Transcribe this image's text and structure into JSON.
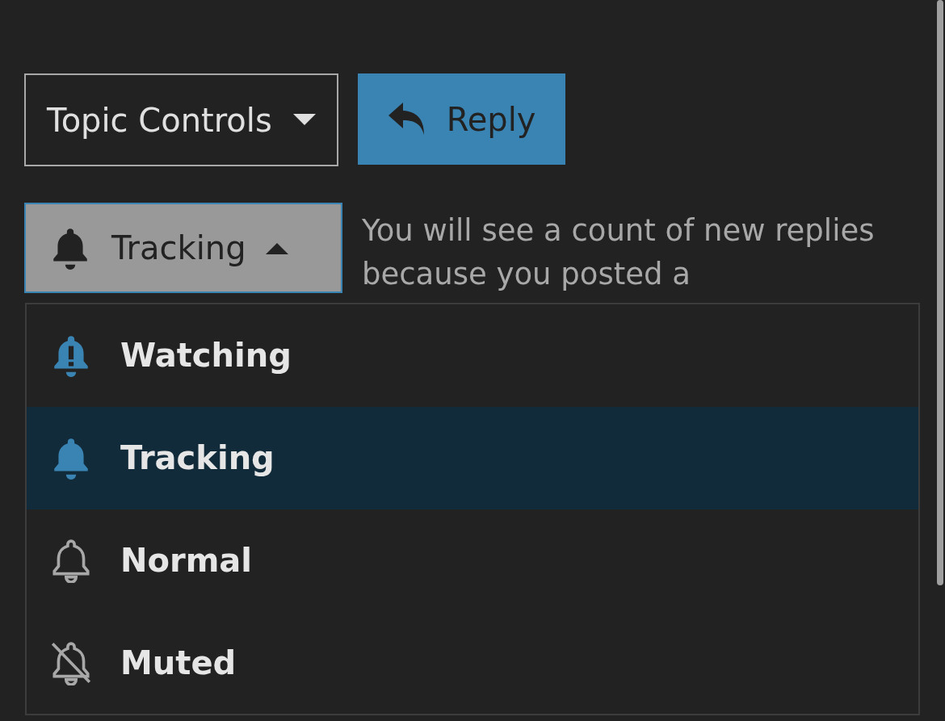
{
  "topic_controls": {
    "label": "Topic Controls",
    "expanded": false
  },
  "reply_button": {
    "label": "Reply"
  },
  "notification_button": {
    "label": "Tracking",
    "expanded": true
  },
  "notification_description": "You will see a count of new replies because you posted a",
  "notification_menu": [
    {
      "kind": "watching",
      "label": "Watching",
      "selected": false
    },
    {
      "kind": "tracking",
      "label": "Tracking",
      "selected": true
    },
    {
      "kind": "normal",
      "label": "Normal",
      "selected": false
    },
    {
      "kind": "muted",
      "label": "Muted",
      "selected": false
    }
  ]
}
